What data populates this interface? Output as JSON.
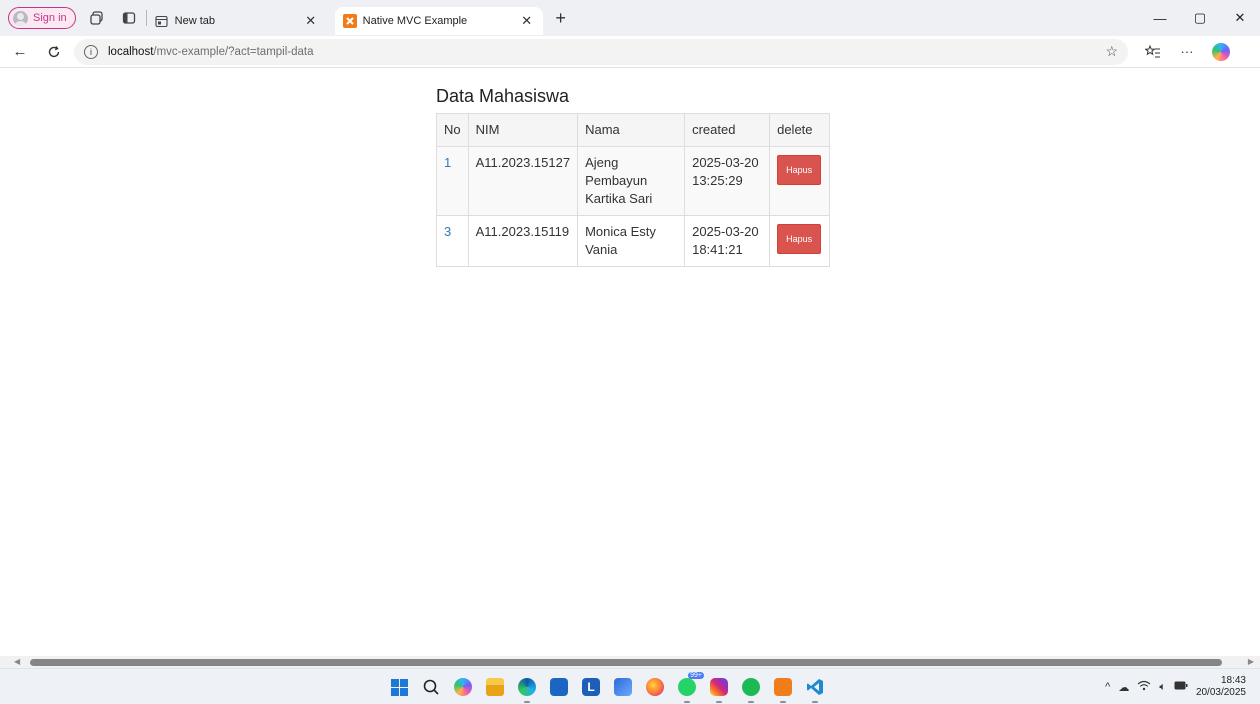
{
  "browser": {
    "signin_label": "Sign in",
    "tabs": [
      {
        "title": "New tab",
        "active": false
      },
      {
        "title": "Native MVC Example",
        "active": true
      }
    ],
    "url_host": "localhost",
    "url_path": "/mvc-example/?act=tampil-data"
  },
  "page": {
    "heading": "Data Mahasiswa",
    "table": {
      "headers": [
        "No",
        "NIM",
        "Nama",
        "created",
        "delete"
      ],
      "rows": [
        {
          "no": "1",
          "nim": "A11.2023.15127",
          "nama": "Ajeng Pembayun Kartika Sari",
          "created": "2025-03-20 13:25:29",
          "action": "Hapus"
        },
        {
          "no": "3",
          "nim": "A11.2023.15119",
          "nama": "Monica Esty Vania",
          "created": "2025-03-20 18:41:21",
          "action": "Hapus"
        }
      ]
    }
  },
  "taskbar": {
    "time": "18:43",
    "date": "20/03/2025",
    "whatsapp_badge": "99+"
  },
  "colors": {
    "danger_button": "#d9534f",
    "link": "#337ab7",
    "signin_accent": "#c7338c"
  }
}
